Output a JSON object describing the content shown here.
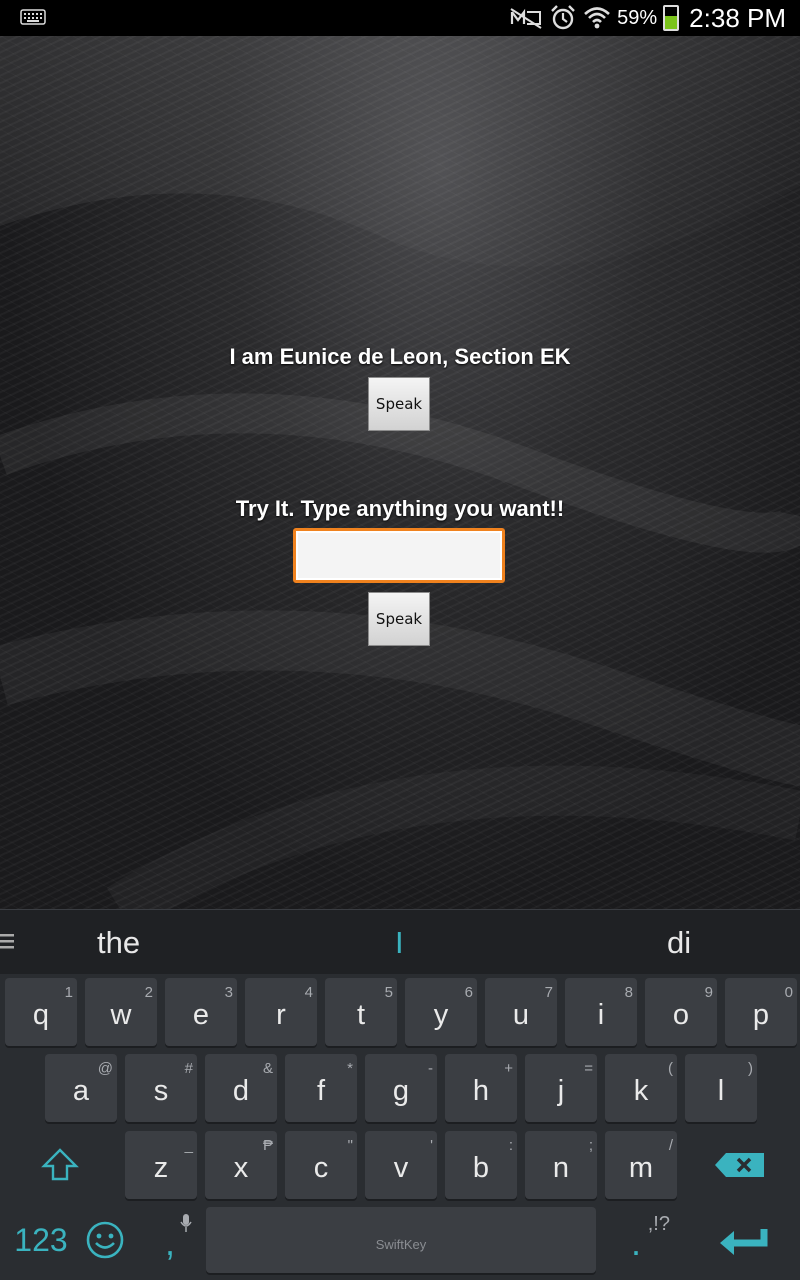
{
  "status_bar": {
    "battery_percent": "59%",
    "battery_level": 0.59,
    "time": "2:38 PM",
    "icons": [
      "keyboard-icon",
      "mute-icon",
      "alarm-icon",
      "wifi-icon",
      "battery-icon"
    ]
  },
  "app": {
    "intro_text": "I am Eunice de Leon, Section EK",
    "speak_button_1": "Speak",
    "prompt_text": "Try It. Type anything you want!!",
    "input_value": "",
    "speak_button_2": "Speak"
  },
  "keyboard": {
    "suggestions": [
      "the",
      "I",
      "di"
    ],
    "row1": [
      {
        "k": "q",
        "a": "1"
      },
      {
        "k": "w",
        "a": "2"
      },
      {
        "k": "e",
        "a": "3"
      },
      {
        "k": "r",
        "a": "4"
      },
      {
        "k": "t",
        "a": "5"
      },
      {
        "k": "y",
        "a": "6"
      },
      {
        "k": "u",
        "a": "7"
      },
      {
        "k": "i",
        "a": "8"
      },
      {
        "k": "o",
        "a": "9"
      },
      {
        "k": "p",
        "a": "0"
      }
    ],
    "row2": [
      {
        "k": "a",
        "a": "@"
      },
      {
        "k": "s",
        "a": "#"
      },
      {
        "k": "d",
        "a": "&"
      },
      {
        "k": "f",
        "a": "*"
      },
      {
        "k": "g",
        "a": "-"
      },
      {
        "k": "h",
        "a": "+"
      },
      {
        "k": "j",
        "a": "="
      },
      {
        "k": "k",
        "a": "("
      },
      {
        "k": "l",
        "a": ")"
      }
    ],
    "row3": [
      {
        "k": "z",
        "a": "_"
      },
      {
        "k": "x",
        "a": "₱"
      },
      {
        "k": "c",
        "a": "\""
      },
      {
        "k": "v",
        "a": "'"
      },
      {
        "k": "b",
        "a": ":"
      },
      {
        "k": "n",
        "a": ";"
      },
      {
        "k": "m",
        "a": "/"
      }
    ],
    "numbers_key": "123",
    "comma_key": ",",
    "period_key": ".",
    "period_alt": ",!?",
    "space_brand": "SwiftKey",
    "accent_color": "#3ab3bf"
  }
}
